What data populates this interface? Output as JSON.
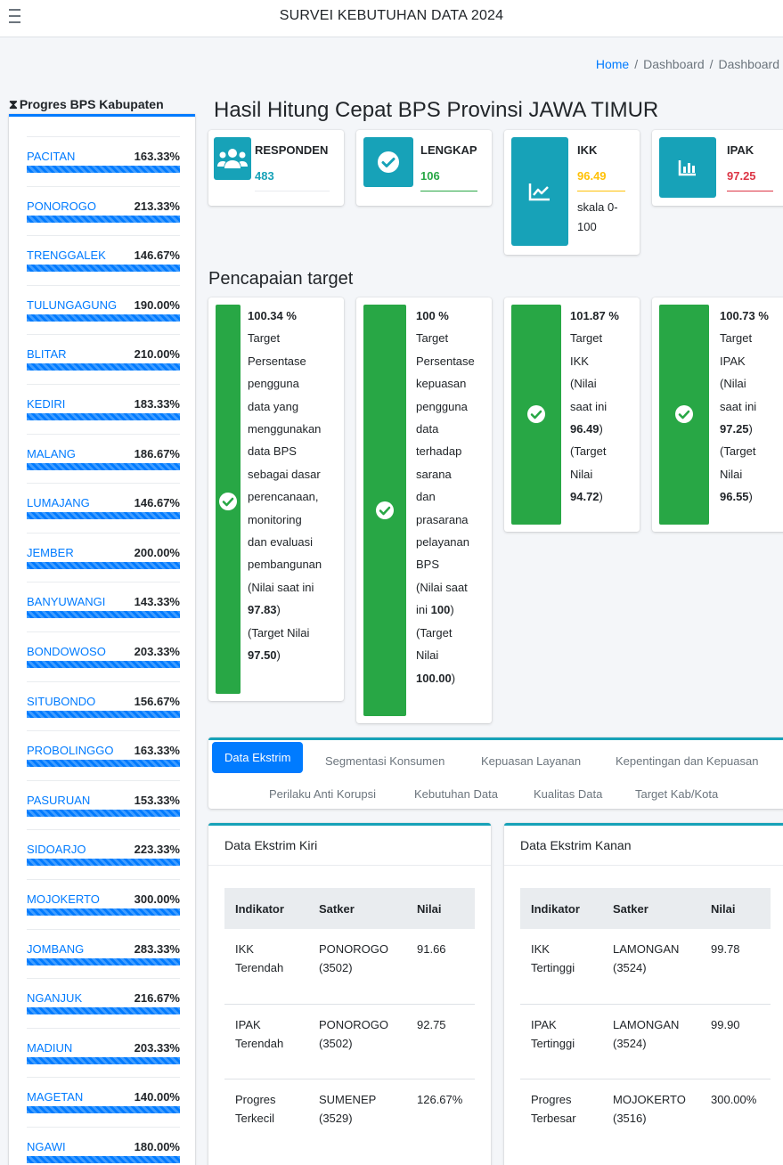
{
  "app": {
    "title": "SURVEI KEBUTUHAN DATA 2024"
  },
  "breadcrumb": [
    "Home",
    "Dashboard",
    "Dashboard"
  ],
  "sidebar": {
    "title": "Progres BPS Kabupaten",
    "items": [
      {
        "name": "PACITAN",
        "pct": "163.33%"
      },
      {
        "name": "PONOROGO",
        "pct": "213.33%"
      },
      {
        "name": "TRENGGALEK",
        "pct": "146.67%"
      },
      {
        "name": "TULUNGAGUNG",
        "pct": "190.00%"
      },
      {
        "name": "BLITAR",
        "pct": "210.00%"
      },
      {
        "name": "KEDIRI",
        "pct": "183.33%"
      },
      {
        "name": "MALANG",
        "pct": "186.67%"
      },
      {
        "name": "LUMAJANG",
        "pct": "146.67%"
      },
      {
        "name": "JEMBER",
        "pct": "200.00%"
      },
      {
        "name": "BANYUWANGI",
        "pct": "143.33%"
      },
      {
        "name": "BONDOWOSO",
        "pct": "203.33%"
      },
      {
        "name": "SITUBONDO",
        "pct": "156.67%"
      },
      {
        "name": "PROBOLINGGO",
        "pct": "163.33%"
      },
      {
        "name": "PASURUAN",
        "pct": "153.33%"
      },
      {
        "name": "SIDOARJO",
        "pct": "223.33%"
      },
      {
        "name": "MOJOKERTO",
        "pct": "300.00%"
      },
      {
        "name": "JOMBANG",
        "pct": "283.33%"
      },
      {
        "name": "NGANJUK",
        "pct": "216.67%"
      },
      {
        "name": "MADIUN",
        "pct": "203.33%"
      },
      {
        "name": "MAGETAN",
        "pct": "140.00%"
      },
      {
        "name": "NGAWI",
        "pct": "180.00%"
      }
    ]
  },
  "main": {
    "title": "Hasil Hitung Cepat BPS Provinsi JAWA TIMUR",
    "info": {
      "responden": {
        "label": "RESPONDEN",
        "value": "483",
        "color": "#17a2b8"
      },
      "lengkap": {
        "label": "LENGKAP",
        "value": "106",
        "color": "#28a745"
      },
      "ikk": {
        "label": "IKK",
        "value": "96.49",
        "sub1": "skala 0-",
        "sub2": "100",
        "color": "#ffc107"
      },
      "ipak": {
        "label": "IPAK",
        "value": "97.25",
        "color": "#dc3545"
      }
    },
    "target_title": "Pencapaian target",
    "targets": [
      {
        "pct": "100.34 %",
        "lines": [
          "Target",
          "Persentase",
          "pengguna",
          "data yang",
          "menggunakan",
          "data BPS",
          "sebagai dasar",
          "perencanaan,",
          "monitoring",
          "dan evaluasi",
          "pembangunan",
          "(Nilai saat ini"
        ],
        "current": "97.83",
        "target_open": "(Target Nilai",
        "target": "97.50"
      },
      {
        "pct": "100 %",
        "lines": [
          "Target",
          "Persentase",
          "kepuasan",
          "pengguna",
          "data",
          "terhadap",
          "sarana",
          "dan",
          "prasarana",
          "pelayanan",
          "BPS",
          "(Nilai saat"
        ],
        "current_prefix": "ini",
        "current": "100",
        "target_open1": "(Target",
        "target_open2": "Nilai",
        "target": "100.00"
      },
      {
        "pct": "101.87 %",
        "lines": [
          "Target",
          "IKK",
          "(Nilai",
          "saat ini"
        ],
        "current": "96.49",
        "target_open1": "(Target",
        "target_open2": "Nilai",
        "target": "94.72"
      },
      {
        "pct": "100.73 %",
        "lines": [
          "Target",
          "IPAK",
          "(Nilai",
          "saat ini"
        ],
        "current": "97.25",
        "target_open1": "(Target",
        "target_open2": "Nilai",
        "target": "96.55"
      }
    ],
    "tabs": [
      "Data Ekstrim",
      "Segmentasi Konsumen",
      "Kepuasan Layanan",
      "Kepentingan dan Kepuasan",
      "Perilaku Anti Korupsi",
      "Kebutuhan Data",
      "Kualitas Data",
      "Target Kab/Kota"
    ],
    "ekstrim_kiri": {
      "title": "Data Ekstrim Kiri",
      "headers": [
        "Indikator",
        "Satker",
        "Nilai"
      ],
      "rows": [
        {
          "ind1": "IKK",
          "ind2": "Terendah",
          "sat1": "PONOROGO",
          "sat2": "(3502)",
          "val": "91.66"
        },
        {
          "ind1": "IPAK",
          "ind2": "Terendah",
          "sat1": "PONOROGO",
          "sat2": "(3502)",
          "val": "92.75"
        },
        {
          "ind1": "Progres",
          "ind2": "Terkecil",
          "sat1": "SUMENEP",
          "sat2": "(3529)",
          "val": "126.67%"
        }
      ]
    },
    "ekstrim_kanan": {
      "title": "Data Ekstrim Kanan",
      "headers": [
        "Indikator",
        "Satker",
        "Nilai"
      ],
      "rows": [
        {
          "ind1": "IKK",
          "ind2": "Tertinggi",
          "sat1": "LAMONGAN",
          "sat2": "(3524)",
          "val": "99.78"
        },
        {
          "ind1": "IPAK",
          "ind2": "Tertinggi",
          "sat1": "LAMONGAN",
          "sat2": "(3524)",
          "val": "99.90"
        },
        {
          "ind1": "Progres",
          "ind2": "Terbesar",
          "sat1": "MOJOKERTO",
          "sat2": "(3516)",
          "val": "300.00%"
        }
      ]
    }
  }
}
